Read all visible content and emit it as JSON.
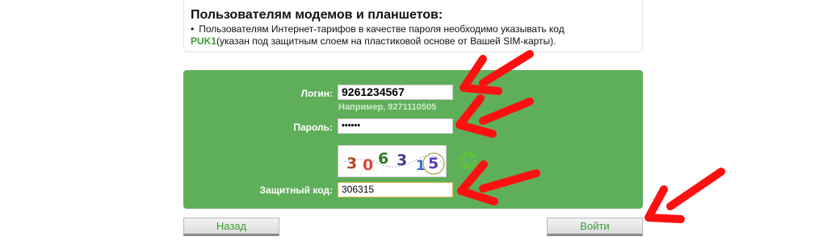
{
  "info": {
    "title": "Пользователям модемов и планшетов:",
    "bullet": "•",
    "line1": "Пользователям Интернет-тарифов в качестве пароля необходимо указывать код",
    "puk": "PUK1",
    "line2_rest": "(указан под защитным слоем на пластиковой основе от Вашей SIM-карты)."
  },
  "form": {
    "login_label": "Логин:",
    "login_value": "9261234567",
    "login_hint": "Например, 9271110505",
    "password_label": "Пароль:",
    "password_value": "••••••",
    "captcha_label": "Защитный код:",
    "captcha_value": "306315",
    "captcha_chars": [
      "3",
      "0",
      "6",
      "3",
      "1",
      "5"
    ]
  },
  "buttons": {
    "back": "Назад",
    "login": "Войти"
  },
  "colors": {
    "form_bg": "#5faf5a",
    "accent_green": "#3f9a36",
    "arrow_red": "#ff1010"
  },
  "icons": {
    "refresh": "refresh-icon",
    "arrow": "red-arrow-annotation"
  }
}
